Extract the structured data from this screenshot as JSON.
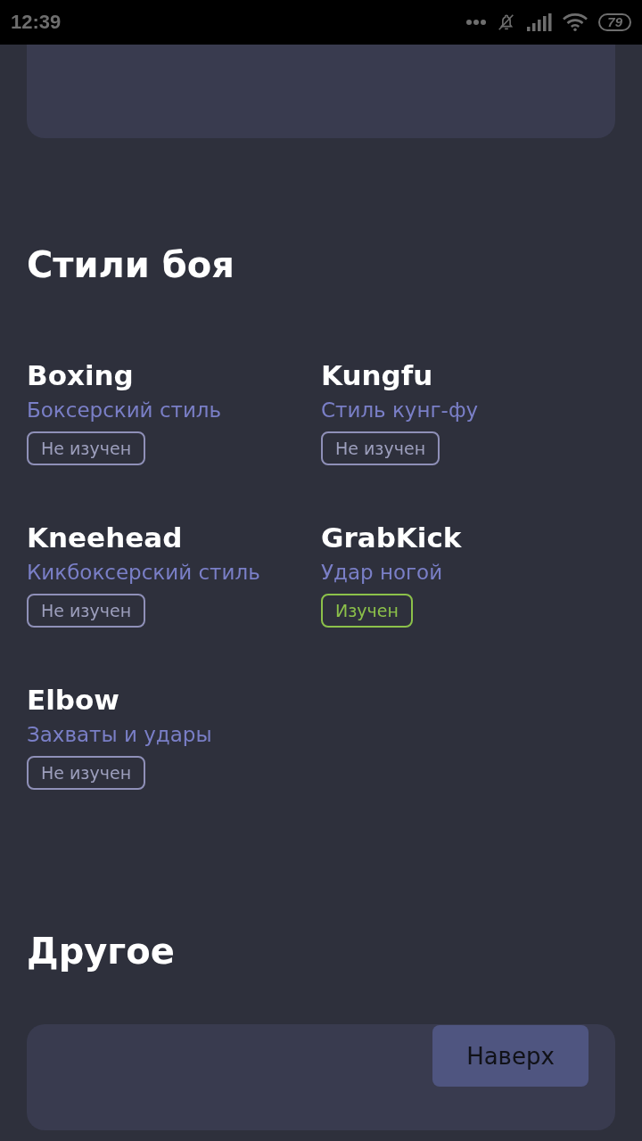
{
  "status_bar": {
    "time": "12:39",
    "battery": "79"
  },
  "styles_section": {
    "title": "Стили боя",
    "styles": [
      {
        "name": "Boxing",
        "description": "Боксерский стиль",
        "status": "Не изучен",
        "learned": false
      },
      {
        "name": "Kungfu",
        "description": "Стиль кунг-фу",
        "status": "Не изучен",
        "learned": false
      },
      {
        "name": "Kneehead",
        "description": "Кикбоксерский стиль",
        "status": "Не изучен",
        "learned": false
      },
      {
        "name": "GrabKick",
        "description": "Удар ногой",
        "status": "Изучен",
        "learned": true
      },
      {
        "name": "Elbow",
        "description": "Захваты и удары",
        "status": "Не изучен",
        "learned": false
      }
    ]
  },
  "other_section": {
    "title": "Другое",
    "button": "Наверх"
  }
}
